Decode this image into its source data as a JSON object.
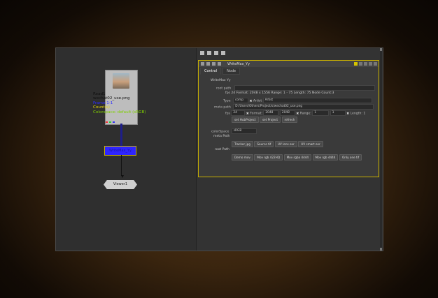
{
  "nodegraph": {
    "read_node": {
      "label_lines": [
        "Read1",
        "wechat02_use.png",
        "Frame 1-1",
        "Count(s)",
        "Colorspace: default (sRGB)"
      ],
      "label_colors": [
        "#111111",
        "#111111",
        "#2c2cff",
        "#e8d800",
        "#7fd000"
      ]
    },
    "write_node": {
      "label": "WriteMax_Yy",
      "color": "#2f25ff"
    },
    "viewer_node": {
      "label": "Viewer1"
    }
  },
  "props": {
    "panel_title": "WriteMax_Yy",
    "tabs": [
      "Control",
      "Node"
    ],
    "active_tab": "Control",
    "node_name": "WriteMax Yy",
    "root_path_label": "root path",
    "info_line": "fps 24  Format: 2048 x 1556  Range: 1 - 75  Length: 75  Node Count:3",
    "type_label": "Type",
    "type_value": "comp",
    "artist_label": "Artist",
    "artist_value": "Artist",
    "meta_path_label": "meta path",
    "meta_path_value": "D:/Users/Others/Project/s/wechat02_use.png",
    "fps_label": "fps",
    "fps_value": "24",
    "format_label": "Format:",
    "format_w": "2048",
    "format_h": "2048",
    "range_label": "Range:",
    "range_start": "1",
    "range_end": "1",
    "length_label": "Length:",
    "length_value": "1",
    "buttons_row1": [
      "set HubProject",
      "set Project",
      "refresh"
    ],
    "colorspace_label": "colorSpace",
    "colorspace_value": "sRGB",
    "meta_path2_label": "meta Path",
    "buttons_row2": [
      "Tracker jpg",
      "Source tif",
      "UV lens exr",
      "UV smart exr"
    ],
    "root_path2_label": "root Path",
    "buttons_row3": [
      "Demo mov",
      "Mov rgb 422HQ",
      "Mov rgba 4444",
      "Mov rgb 4444",
      "Only one tif"
    ]
  }
}
